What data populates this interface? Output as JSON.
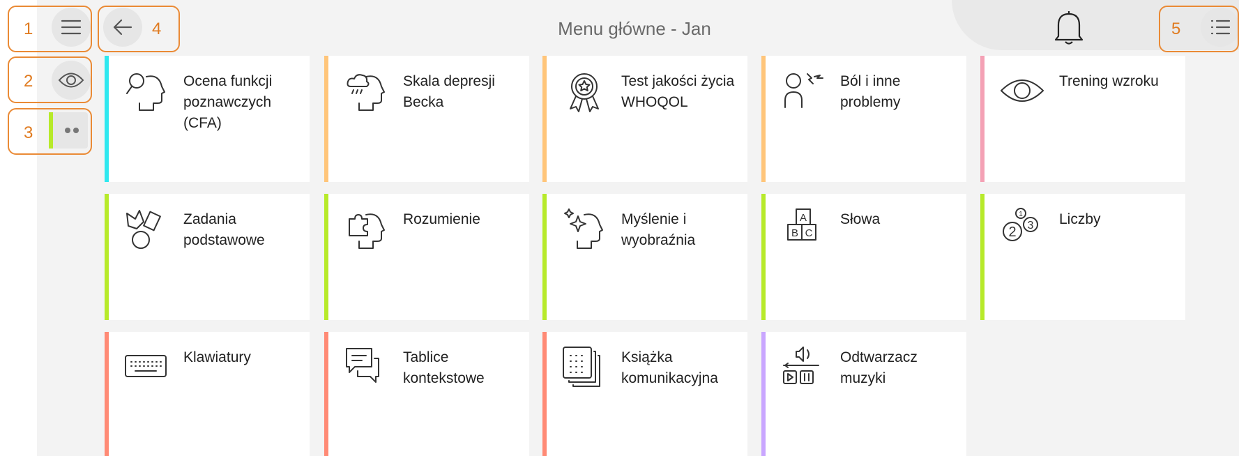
{
  "header": {
    "title": "Menu główne - Jan"
  },
  "callouts": [
    "1",
    "2",
    "3",
    "4",
    "5"
  ],
  "colors": {
    "cyan": "#2ee8ef",
    "orange": "#ffc57a",
    "pink": "#f4a1b5",
    "lime": "#b7ea2a",
    "salmon": "#ff8a75",
    "purple": "#c9a6ff",
    "callout": "#ea8a35"
  },
  "tiles": [
    {
      "label": "Ocena funkcji poznawczych (CFA)",
      "icon": "head-magnifier-icon",
      "accent": "cyan"
    },
    {
      "label": "Skala depresji Becka",
      "icon": "head-raincloud-icon",
      "accent": "orange"
    },
    {
      "label": "Test jakości życia WHOQOL",
      "icon": "award-ribbon-icon",
      "accent": "orange"
    },
    {
      "label": "Ból i inne problemy",
      "icon": "person-pain-icon",
      "accent": "orange"
    },
    {
      "label": "Trening wzroku",
      "icon": "eye-icon",
      "accent": "pink"
    },
    {
      "label": "Zadania podstawowe",
      "icon": "shapes-icon",
      "accent": "lime"
    },
    {
      "label": "Rozumienie",
      "icon": "head-puzzle-icon",
      "accent": "lime"
    },
    {
      "label": "Myślenie i wyobraźnia",
      "icon": "head-sparkle-icon",
      "accent": "lime"
    },
    {
      "label": "Słowa",
      "icon": "abc-blocks-icon",
      "accent": "lime"
    },
    {
      "label": "Liczby",
      "icon": "numbers-icon",
      "accent": "lime"
    },
    {
      "label": "Klawiatury",
      "icon": "keyboard-icon",
      "accent": "salmon"
    },
    {
      "label": "Tablice kontekstowe",
      "icon": "chat-bubbles-icon",
      "accent": "salmon"
    },
    {
      "label": "Książka komunikacyjna",
      "icon": "book-grid-icon",
      "accent": "salmon"
    },
    {
      "label": "Odtwarzacz muzyki",
      "icon": "music-player-icon",
      "accent": "purple"
    }
  ]
}
